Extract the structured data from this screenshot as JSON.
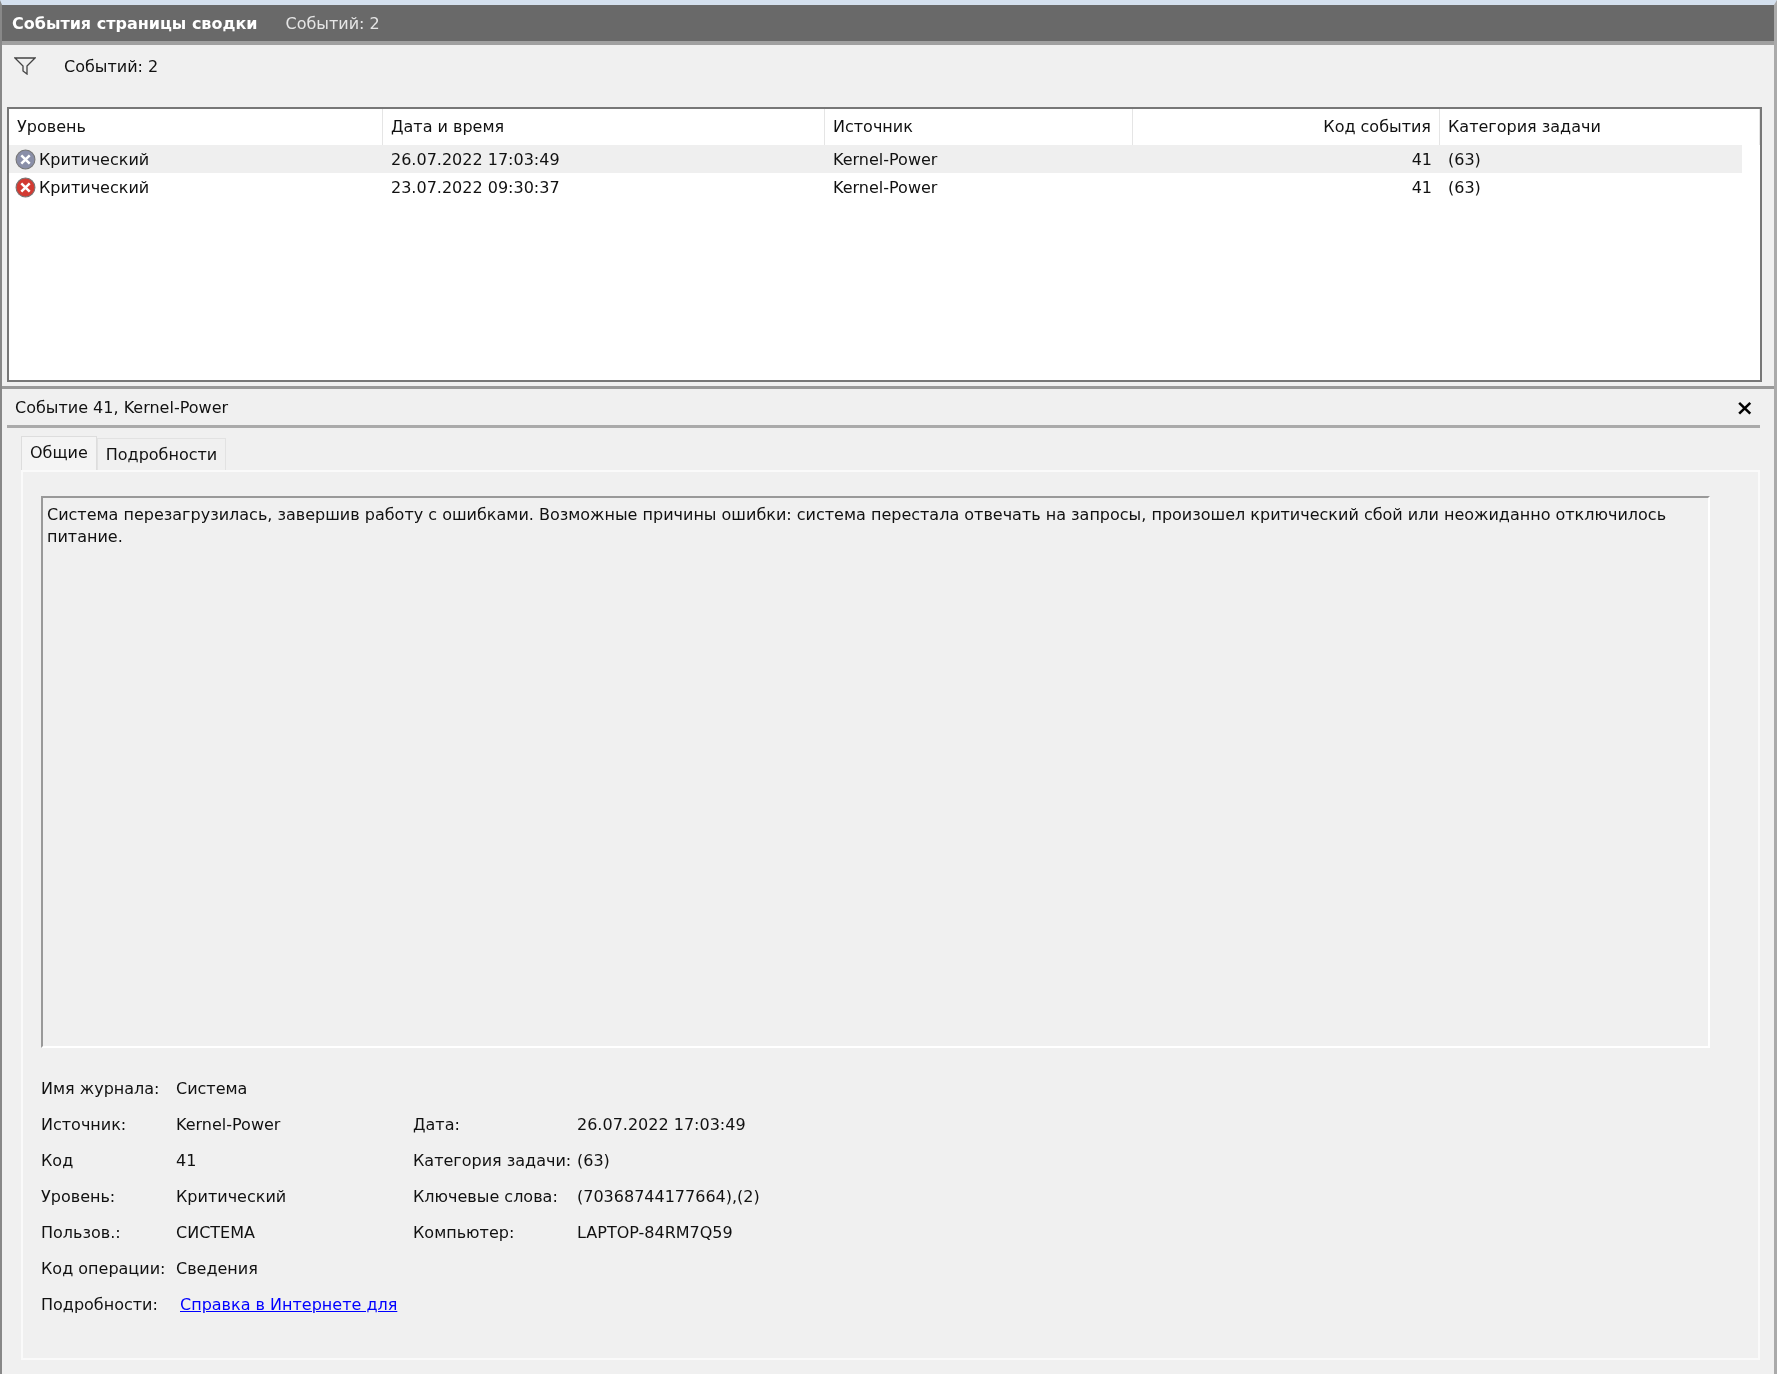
{
  "header": {
    "title": "События страницы сводки",
    "count": "Событий: 2"
  },
  "toolbar": {
    "count": "Событий: 2"
  },
  "table": {
    "columns": [
      {
        "label": "Уровень",
        "numeric": false
      },
      {
        "label": "Дата и время",
        "numeric": false
      },
      {
        "label": "Источник",
        "numeric": false
      },
      {
        "label": "Код события",
        "numeric": true
      },
      {
        "label": "Категория задачи",
        "numeric": false
      }
    ],
    "rows": [
      {
        "selected": true,
        "cells": [
          "Критический",
          "26.07.2022 17:03:49",
          "Kernel-Power",
          "41",
          "(63)"
        ]
      },
      {
        "selected": false,
        "cells": [
          "Критический",
          "23.07.2022 09:30:37",
          "Kernel-Power",
          "41",
          "(63)"
        ]
      }
    ]
  },
  "detail": {
    "title": "Событие 41, Kernel-Power",
    "close": "×",
    "tabs": [
      {
        "label": "Общие",
        "selected": true
      },
      {
        "label": "Подробности",
        "selected": false
      }
    ],
    "description": "Система перезагрузилась, завершив работу с ошибками. Возможные причины ошибки: система перестала отвечать на запросы, произошел критический сбой или неожиданно отключилось питание.",
    "fields": [
      [
        {
          "label": "Имя журнала:",
          "value": "Система"
        }
      ],
      [
        {
          "label": "Источник:",
          "value": "Kernel-Power"
        },
        {
          "label": "Дата:",
          "value": "26.07.2022 17:03:49"
        }
      ],
      [
        {
          "label": "Код",
          "value": "41"
        },
        {
          "label": "Категория задачи:",
          "value": "(63)"
        }
      ],
      [
        {
          "label": "Уровень:",
          "value": "Критический"
        },
        {
          "label": "Ключевые слова:",
          "value": "(70368744177664),(2)"
        }
      ],
      [
        {
          "label": "Пользов.:",
          "value": "СИСТЕМА"
        },
        {
          "label": "Компьютер:",
          "value": "LAPTOP-84RM7Q59"
        }
      ],
      [
        {
          "label": "Код операции:",
          "value": "Сведения"
        }
      ],
      [
        {
          "label": "Подробности:",
          "value": "Справка в Интернете для ",
          "kind": "link"
        }
      ]
    ]
  }
}
